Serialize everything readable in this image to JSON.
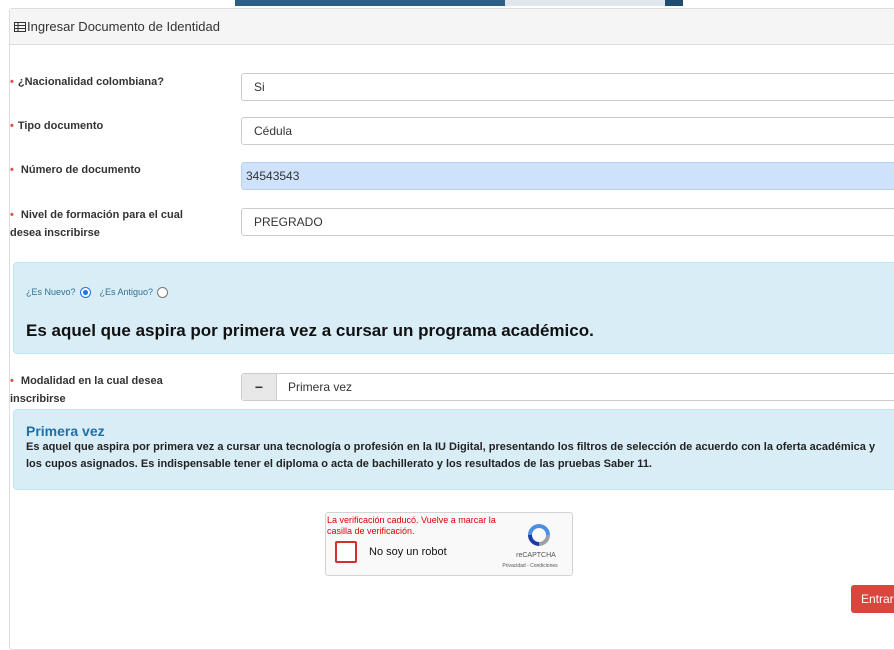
{
  "panel": {
    "title": "Ingresar Documento de Identidad"
  },
  "form": {
    "nacionalidad": {
      "label": "¿Nacionalidad colombiana?",
      "value": "Si"
    },
    "tipo_documento": {
      "label": "Tipo documento",
      "value": "Cédula"
    },
    "numero_documento": {
      "label": "Número de documento",
      "value": "34543543"
    },
    "nivel_formacion": {
      "label_line1": "Nivel de formación para el cual",
      "label_line2": "desea inscribirse",
      "value": "PREGRADO"
    },
    "modalidad": {
      "label_line1": "Modalidad en la cual desea",
      "label_line2": "inscribirse",
      "value": "Primera vez",
      "button_symbol": "−"
    }
  },
  "aspirant_type": {
    "nuevo_label": "¿Es Nuevo?",
    "antiguo_label": "¿Es Antiguo?",
    "selected": "nuevo",
    "description": "Es aquel que aspira por primera vez a cursar un programa académico."
  },
  "primera_vez_info": {
    "title": "Primera vez",
    "description": "Es aquel que aspira por primera vez a cursar una tecnología o profesión en la IU Digital, presentando los filtros de selección de acuerdo con la oferta académica y los cupos asignados. Es indispensable tener el diploma o acta de bachillerato y los resultados de las pruebas Saber 11."
  },
  "captcha": {
    "error": "La verificación caducó. Vuelve a marcar la casilla de verificación.",
    "label": "No soy un robot",
    "brand": "reCAPTCHA",
    "links": "Privacidad - Condiciones"
  },
  "actions": {
    "submit_label": "Entrar"
  },
  "colors": {
    "required": "#d9534f",
    "info_bg": "#d9edf7",
    "link_blue": "#1f6fa8",
    "submit_bg": "#d9463e"
  }
}
